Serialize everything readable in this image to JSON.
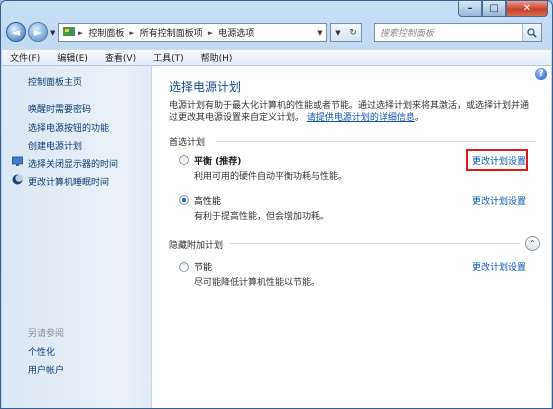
{
  "window": {
    "controls": {
      "minimize": "–",
      "maximize": "□",
      "close": "✕"
    }
  },
  "address": {
    "breadcrumbs": [
      "控制面板",
      "所有控制面板项",
      "电源选项"
    ],
    "search_placeholder": "搜索控制面板"
  },
  "menu": [
    "文件(F)",
    "编辑(E)",
    "查看(V)",
    "工具(T)",
    "帮助(H)"
  ],
  "sidebar": {
    "home": "控制面板主页",
    "items": [
      "唤醒时需要密码",
      "选择电源按钮的功能",
      "创建电源计划",
      "选择关闭显示器的时间",
      "更改计算机睡眠时间"
    ],
    "see_also_label": "另请参阅",
    "see_also": [
      "个性化",
      "用户帐户"
    ]
  },
  "main": {
    "title": "选择电源计划",
    "description": "电源计划有助于最大化计算机的性能或者节能。通过选择计划来将其激活，或选择计划并通过更改其电源设置来自定义计划。",
    "details_link": "请提供电源计划的详细信息",
    "preferred_label": "首选计划",
    "hidden_label": "隐藏附加计划",
    "plans": [
      {
        "name": "平衡 (推荐)",
        "desc": "利用可用的硬件自动平衡功耗与性能。",
        "link": "更改计划设置",
        "selected": false
      },
      {
        "name": "高性能",
        "desc": "有利于提高性能，但会增加功耗。",
        "link": "更改计划设置",
        "selected": true
      },
      {
        "name": "节能",
        "desc": "尽可能降低计算机性能以节能。",
        "link": "更改计划设置",
        "selected": false
      }
    ]
  },
  "colors": {
    "accent_link": "#0b54b0",
    "title": "#1b4d8f",
    "highlight_box": "#e01818"
  }
}
